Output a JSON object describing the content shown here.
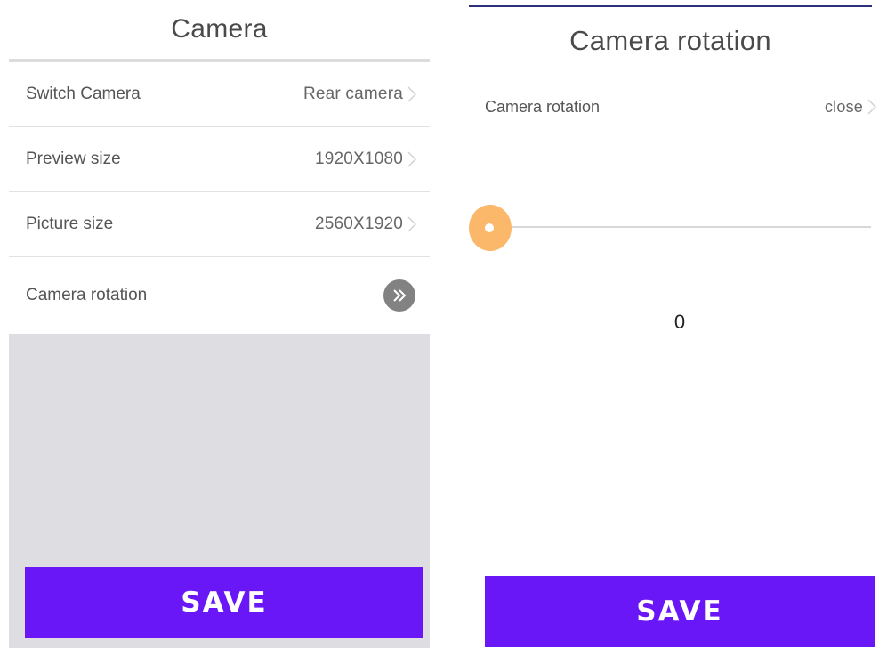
{
  "left": {
    "title": "Camera",
    "rows": [
      {
        "label": "Switch Camera",
        "value": "Rear camera"
      },
      {
        "label": "Preview size",
        "value": "1920X1080"
      },
      {
        "label": "Picture size",
        "value": "2560X1920"
      },
      {
        "label": "Camera rotation",
        "icon": "double-chevron-right-icon"
      }
    ],
    "save_label": "SAVE"
  },
  "right": {
    "title": "Camera rotation",
    "rotation_label": "Camera rotation",
    "rotation_value": "close",
    "slider_level": 0,
    "field_value": "0",
    "save_label": "SAVE"
  },
  "colors": {
    "accent": "#6a17f8",
    "slider_thumb": "#fcb86a",
    "round_button": "#828282",
    "empty_area": "#dedee2"
  }
}
